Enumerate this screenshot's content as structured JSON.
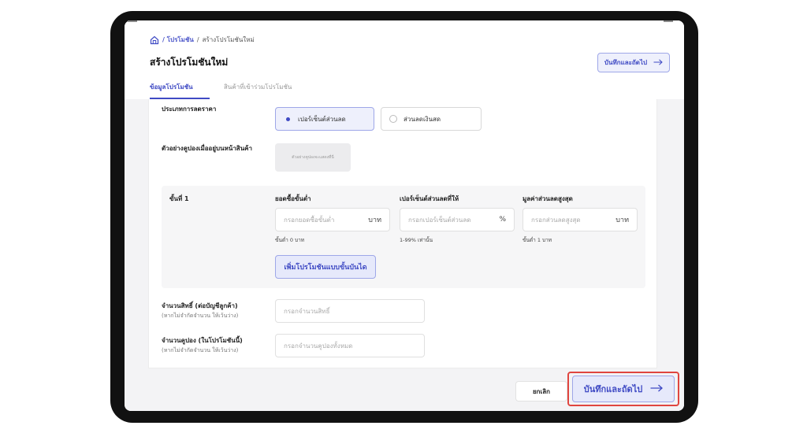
{
  "breadcrumb": {
    "promotions_link": "/ โปรโมชัน",
    "sep": "/",
    "current": "สร้างโปรโมชันใหม่"
  },
  "page_title": "สร้างโปรโมชันใหม่",
  "header_button": {
    "label": "บันทึกและถัดไป",
    "icon": "arrow-right-icon"
  },
  "tabs": [
    {
      "label": "ข้อมูลโปรโมชัน",
      "active": true
    },
    {
      "label": "สินค้าที่เข้าร่วมโปรโมชัน",
      "active": false
    }
  ],
  "discount_type": {
    "label": "ประเภทการลดราคา",
    "options": [
      {
        "label": "เปอร์เซ็นต์ส่วนลด",
        "selected": true
      },
      {
        "label": "ส่วนลดเงินสด",
        "selected": false
      }
    ]
  },
  "coupon_preview": {
    "label": "ตัวอย่างคูปองเมื่ออยู่บนหน้าสินค้า",
    "placeholder": "ตัวอย่างคูปองจะแสดงที่นี่"
  },
  "tier": {
    "label": "ขั้นที่ 1",
    "min_purchase": {
      "label": "ยอดซื้อขั้นต่ำ",
      "placeholder": "กรอกยอดซื้อขั้นต่ำ",
      "unit": "บาท",
      "hint": "ขั้นต่ำ 0 บาท"
    },
    "percent": {
      "label": "เปอร์เซ็นต์ส่วนลดที่ให้",
      "placeholder": "กรอกเปอร์เซ็นต์ส่วนลด",
      "unit": "%",
      "hint": "1-99% เท่านั้น"
    },
    "max_discount": {
      "label": "มูลค่าส่วนลดสูงสุด",
      "placeholder": "กรอกส่วนลดสูงสุด",
      "unit": "บาท",
      "hint": "ขั้นต่ำ 1 บาท"
    },
    "add_button": "เพิ่มโปรโมชันแบบขั้นบันได"
  },
  "rights": {
    "label": "จำนวนสิทธิ์ (ต่อบัญชีลูกค้า)",
    "sublabel": "(หากไม่จำกัดจำนวน ให้เว้นว่าง)",
    "placeholder": "กรอกจำนวนสิทธิ์"
  },
  "coupons": {
    "label": "จำนวนคูปอง (ในโปรโมชันนี้)",
    "sublabel": "(หากไม่จำกัดจำนวน ให้เว้นว่าง)",
    "placeholder": "กรอกจำนวนคูปองทั้งหมด"
  },
  "footer": {
    "cancel_label": "ยกเลิก",
    "save_label": "บันทึกและถัดไป",
    "save_icon": "arrow-right-icon"
  },
  "colors": {
    "accent": "#3f4ac4",
    "accent_bg": "#eef0fc",
    "highlight": "#e0453f"
  }
}
